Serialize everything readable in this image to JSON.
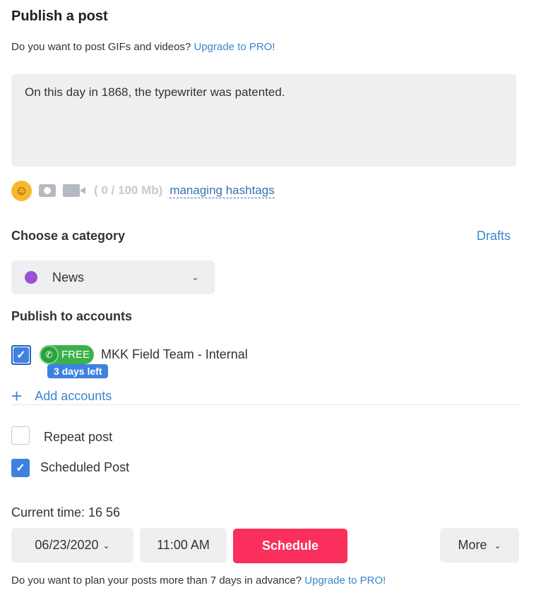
{
  "title": "Publish a post",
  "upgrade_prompt": {
    "text": "Do you want to post GIFs and videos?",
    "link": "Upgrade to PRO!"
  },
  "post_text": "On this day in 1868, the typewriter was patented.",
  "media": {
    "size": "( 0 / 100 Mb)",
    "hashtags_link": "managing hashtags"
  },
  "category": {
    "label": "Choose a category",
    "drafts": "Drafts",
    "selected": "News",
    "color": "#9b50d8"
  },
  "accounts": {
    "label": "Publish to accounts",
    "items": [
      {
        "name": "MKK Field Team - Internal",
        "checked": true,
        "badge": "FREE",
        "trial": "3 days left",
        "network": "whatsapp"
      }
    ],
    "add": "Add accounts"
  },
  "options": {
    "repeat": {
      "label": "Repeat post",
      "checked": false
    },
    "scheduled": {
      "label": "Scheduled Post",
      "checked": true
    }
  },
  "schedule": {
    "current_time": "Current time: 16 56",
    "date": "06/23/2020",
    "time": "11:00 AM",
    "button": "Schedule",
    "more": "More"
  },
  "footer": {
    "text": "Do you want to plan your posts more than 7 days in advance?",
    "link": "Upgrade to PRO!"
  }
}
